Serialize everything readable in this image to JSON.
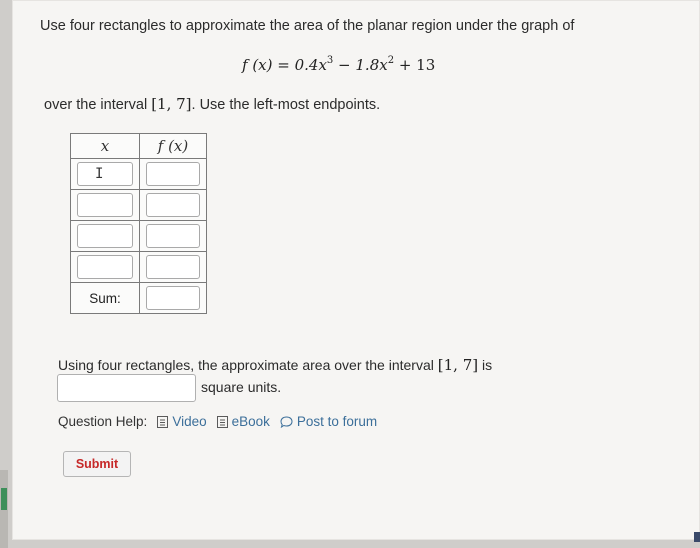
{
  "question": {
    "intro": "Use four rectangles to approximate the area of the planar region under the graph of",
    "formula": {
      "lhs": "f (x) = 0.4x",
      "exp1": "3",
      "mid": " − 1.8x",
      "exp2": "2",
      "rhs": " + 13"
    },
    "interval_prefix": "over the interval ",
    "interval": "[1, 7]",
    "interval_suffix": ". Use the left-most endpoints."
  },
  "table": {
    "col_x_header": "x",
    "col_f_header": "f (x)",
    "rows": 4,
    "sum_label": "Sum:"
  },
  "answer": {
    "prefix": "Using four rectangles, the approximate area over the interval ",
    "interval": "[1, 7]",
    "suffix": " is",
    "units": "square units."
  },
  "help": {
    "label": "Question Help:",
    "video": "Video",
    "ebook": "eBook",
    "forum": "Post to forum"
  },
  "submit_label": "Submit",
  "colors": {
    "link": "#3c6f9a",
    "submit_text": "#c62828"
  }
}
